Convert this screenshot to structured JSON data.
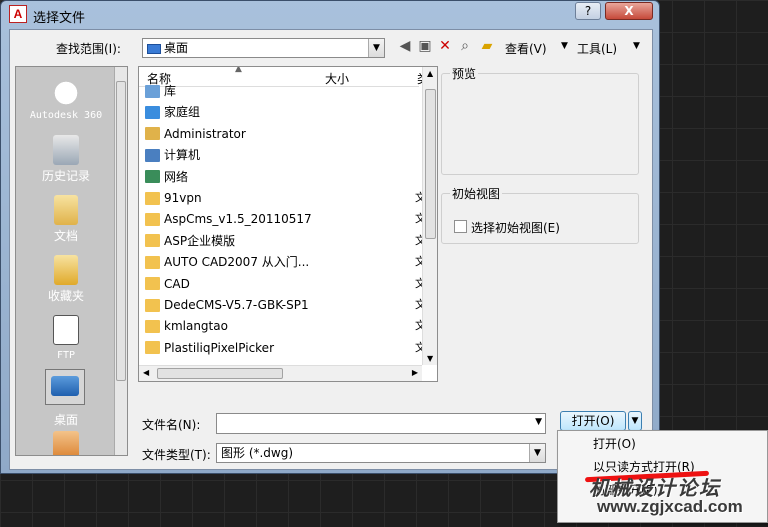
{
  "window": {
    "app_icon_letter": "A",
    "title": "选择文件",
    "help_label": "?",
    "close_label": "X"
  },
  "toolbar": {
    "look_in_label": "查找范围(I):",
    "look_in_value": "桌面",
    "views_label": "查看(V)",
    "tools_label": "工具(L)"
  },
  "places": [
    {
      "label": "Autodesk 360",
      "icon": "cloud-icon"
    },
    {
      "label": "历史记录",
      "icon": "history-icon"
    },
    {
      "label": "文档",
      "icon": "documents-folder-icon"
    },
    {
      "label": "收藏夹",
      "icon": "favorites-folder-icon"
    },
    {
      "label": "FTP",
      "icon": "ftp-icon"
    },
    {
      "label": "桌面",
      "icon": "desktop-icon"
    }
  ],
  "filelist": {
    "col_name": "名称",
    "col_size": "大小",
    "col_type": "类",
    "items": [
      {
        "name": "库",
        "icon": "library-icon",
        "type": ""
      },
      {
        "name": "家庭组",
        "icon": "homegroup-icon",
        "type": ""
      },
      {
        "name": "Administrator",
        "icon": "user-folder-icon",
        "type": ""
      },
      {
        "name": "计算机",
        "icon": "computer-icon",
        "type": ""
      },
      {
        "name": "网络",
        "icon": "network-icon",
        "type": ""
      },
      {
        "name": "91vpn",
        "icon": "folder-icon",
        "type": "文"
      },
      {
        "name": "AspCms_v1.5_20110517",
        "icon": "folder-icon",
        "type": "文"
      },
      {
        "name": "ASP企业模版",
        "icon": "folder-icon",
        "type": "文"
      },
      {
        "name": "AUTO CAD2007 从入门...",
        "icon": "folder-icon",
        "type": "文"
      },
      {
        "name": "CAD",
        "icon": "folder-icon",
        "type": "文"
      },
      {
        "name": "DedeCMS-V5.7-GBK-SP1",
        "icon": "folder-icon",
        "type": "文"
      },
      {
        "name": "kmlangtao",
        "icon": "folder-icon",
        "type": "文"
      },
      {
        "name": "PlastiliqPixelPicker",
        "icon": "folder-icon",
        "type": "文"
      }
    ]
  },
  "preview": {
    "label": "预览"
  },
  "initial_view": {
    "label": "初始视图",
    "checkbox_label": "选择初始视图(E)"
  },
  "bottom": {
    "filename_label": "文件名(N):",
    "filename_value": "",
    "filetype_label": "文件类型(T):",
    "filetype_value": "图形 (*.dwg)",
    "open_label": "打开(O)"
  },
  "open_menu": {
    "items": [
      "打开(O)",
      "以只读方式打开(R)",
      "局部打开(P)"
    ]
  },
  "watermark": {
    "line1": "机械设计论坛",
    "line2": "www.zgjxcad.com"
  },
  "colors": {
    "folder": "#f2c24f",
    "title_bar": "#a9c1dc",
    "close_button": "#c64a3a",
    "highlight_red": "#e11111"
  }
}
